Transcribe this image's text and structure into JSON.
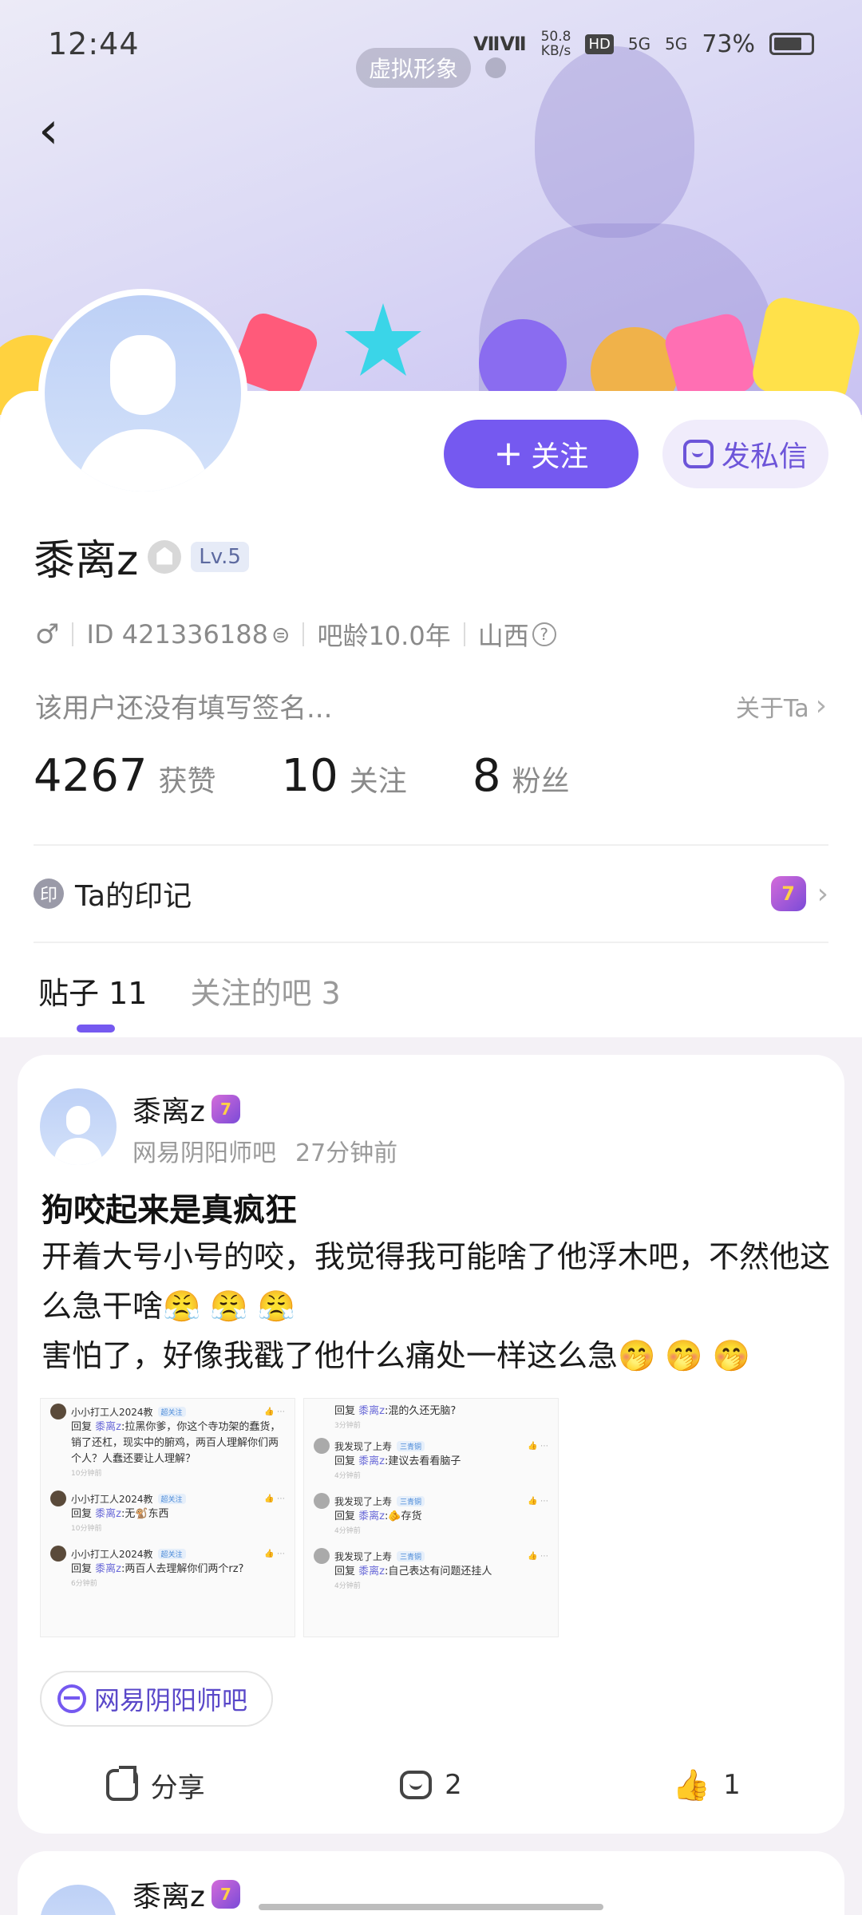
{
  "status_bar": {
    "time": "12:44",
    "speed_value": "50.8",
    "speed_unit": "KB/s",
    "hd": "HD",
    "net1": "5G",
    "net2": "5G",
    "battery": "73%"
  },
  "header": {
    "virtual_avatar_label": "虚拟形象",
    "back_icon": "‹"
  },
  "profile": {
    "username": "黍离z",
    "level": "Lv.5",
    "id_text": "ID 421336188",
    "bar_age": "吧龄10.0年",
    "location": "山西",
    "signature": "该用户还没有填写签名...",
    "about_label": "关于Ta",
    "follow_label": "关注",
    "message_label": "发私信",
    "stats": {
      "likes_num": "4267",
      "likes_label": "获赞",
      "following_num": "10",
      "following_label": "关注",
      "fans_num": "8",
      "fans_label": "粉丝"
    },
    "imprint_label": "Ta的印记",
    "imprint_badge": "7",
    "seal_char": "印"
  },
  "tabs": [
    {
      "label": "贴子 11",
      "active": true
    },
    {
      "label": "关注的吧 3",
      "active": false
    }
  ],
  "post": {
    "author": "黍离z",
    "badge": "7",
    "forum": "网易阴阳师吧",
    "time": "27分钟前",
    "title": "狗咬起来是真疯狂",
    "body_line1": "开着大号小号的咬，我觉得我可能啥了他浮木吧，不然他这么急干啥😤 😤 😤",
    "body_line2": "害怕了，好像我戳了他什么痛处一样这么急🤭 🤭 🤭",
    "forum_pill": "网易阴阳师吧",
    "share_label": "分享",
    "comment_count": "2",
    "like_count": "1",
    "thumb1": {
      "comments": [
        {
          "user": "小小打工人2024教",
          "tag": "超关注",
          "reply_to": "黍离z",
          "text": ":拉黑你爹，你这个寺功架的蠢货，销了还杠，现实中的腑鸡，两百人理解你们两个人？人蠢还要让人理解？",
          "time": "10分钟前"
        },
        {
          "user": "小小打工人2024教",
          "tag": "超关注",
          "reply_to": "黍离z",
          "text": ":无🐒东西",
          "time": "10分钟前"
        },
        {
          "user": "小小打工人2024教",
          "tag": "超关注",
          "reply_to": "黍离z",
          "text": ":两百人去理解你们两个rz?",
          "time": "6分钟前"
        }
      ]
    },
    "thumb2": {
      "comments": [
        {
          "user": "",
          "tag": "",
          "reply_to": "黍离z",
          "text": ":混的久还无脑?",
          "time": "3分钟前"
        },
        {
          "user": "我发现了上寿",
          "tag": "三青铜",
          "reply_to": "黍离z",
          "text": ":建议去看看脑子",
          "time": "4分钟前"
        },
        {
          "user": "我发现了上寿",
          "tag": "三青铜",
          "reply_to": "黍离z",
          "text": ":🫵存货",
          "time": "4分钟前"
        },
        {
          "user": "我发现了上寿",
          "tag": "三青铜",
          "reply_to": "黍离z",
          "text": ":自己表达有问题还挂人",
          "time": "4分钟前"
        }
      ]
    },
    "reply_prefix": "回复"
  },
  "next_post": {
    "author": "黍离z",
    "badge": "7"
  }
}
